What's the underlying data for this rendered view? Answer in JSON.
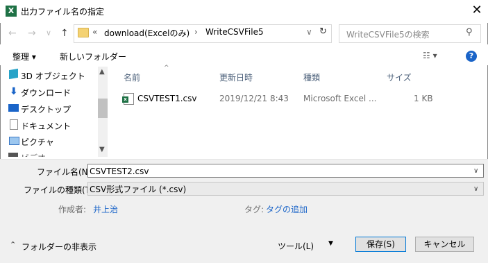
{
  "window": {
    "app_icon": "excel-icon",
    "title": "出力ファイル名の指定",
    "close": "✕"
  },
  "nav": {
    "back": "←",
    "forward": "→",
    "dropdown": "∨",
    "up": "↑",
    "overflow": "«",
    "crumbs": [
      "download(Excelのみ)",
      "WriteCSVFile5"
    ],
    "crumb_sep": "›",
    "refresh": "↻",
    "search_placeholder": "WriteCSVFile5の検索"
  },
  "toolbar": {
    "organize": "整理 ▾",
    "new_folder": "新しいフォルダー",
    "help": "?"
  },
  "sidebar": {
    "items": [
      {
        "label": "3D オブジェクト",
        "icon": "3d-objects-icon"
      },
      {
        "label": "ダウンロード",
        "icon": "download-icon"
      },
      {
        "label": "デスクトップ",
        "icon": "desktop-icon"
      },
      {
        "label": "ドキュメント",
        "icon": "documents-icon"
      },
      {
        "label": "ピクチャ",
        "icon": "pictures-icon"
      },
      {
        "label": "ビデオ",
        "icon": "videos-icon"
      }
    ]
  },
  "columns": {
    "name": "名前",
    "modified": "更新日時",
    "type": "種類",
    "size": "サイズ"
  },
  "files": [
    {
      "name": "CSVTEST1.csv",
      "modified": "2019/12/21 8:43",
      "type": "Microsoft Excel ...",
      "size": "1 KB",
      "icon": "excel-csv-icon"
    }
  ],
  "form": {
    "filename_label": "ファイル名(N):",
    "filename_value": "CSVTEST2.csv",
    "filetype_label": "ファイルの種類(T):",
    "filetype_value": "CSV形式ファイル (*.csv)",
    "author_label": "作成者:",
    "author_value": "井上治",
    "tags_label": "タグ:",
    "tags_value": "タグの追加"
  },
  "footer": {
    "hide_folders": "フォルダーの非表示",
    "tools": "ツール(L)",
    "save": "保存(S)",
    "cancel": "キャンセル"
  },
  "colors": {
    "accent": "#0078d7",
    "link": "#1a64c8",
    "excel_green": "#1e7145"
  }
}
